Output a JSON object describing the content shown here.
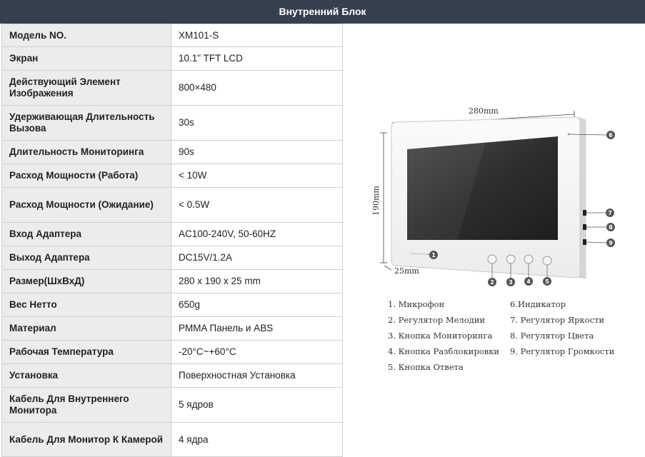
{
  "header": {
    "title": "Внутренний Блок"
  },
  "specs": [
    {
      "label": "Модель NO.",
      "value": "XM101-S"
    },
    {
      "label": "Экран",
      "value": "10.1\" TFT LCD"
    },
    {
      "label": "Действующий Элемент Изображения",
      "value": "800×480"
    },
    {
      "label": "Удерживающая Длительность Вызова",
      "value": "30s"
    },
    {
      "label": "Длительность Мониторинга",
      "value": "90s"
    },
    {
      "label": "Расход Мощности (Работа)",
      "value": "< 10W"
    },
    {
      "label": "Расход Мощности (Ожидание)",
      "value": "< 0.5W"
    },
    {
      "label": "Вход Адаптера",
      "value": "AC100-240V, 50-60HZ"
    },
    {
      "label": "Выход Адаптера",
      "value": "DC15V/1.2A"
    },
    {
      "label": "Размер(ШхВхД)",
      "value": "280 x 190 x 25 mm"
    },
    {
      "label": "Вес Нетто",
      "value": "650g"
    },
    {
      "label": "Материал",
      "value": "PMMA Панель и ABS"
    },
    {
      "label": "Рабочая Температура",
      "value": "-20°C~+60°C"
    },
    {
      "label": "Установка",
      "value": "Поверхностная Установка"
    },
    {
      "label": "Кабель Для Внутреннего Монитора",
      "value": "5 ядров"
    },
    {
      "label": "Кабель Для Монитор К Камерой",
      "value": "4 ядра"
    }
  ],
  "diagram": {
    "width_label": "280mm",
    "height_label": "190mm",
    "depth_label": "25mm",
    "callouts": [
      "1",
      "2",
      "3",
      "4",
      "5",
      "6",
      "7",
      "8",
      "9"
    ]
  },
  "legend": [
    "1. Микрофон",
    "2. Регулятор Мелодии",
    "3. Кнопка Мониторинга",
    "4. Кнопка Разблокировки",
    "5. Кнопка Ответа",
    "6.Индикатор",
    "7. Регулятор Яркости",
    "8. Регулятор Цвета",
    "9. Регулятор Громкости"
  ]
}
